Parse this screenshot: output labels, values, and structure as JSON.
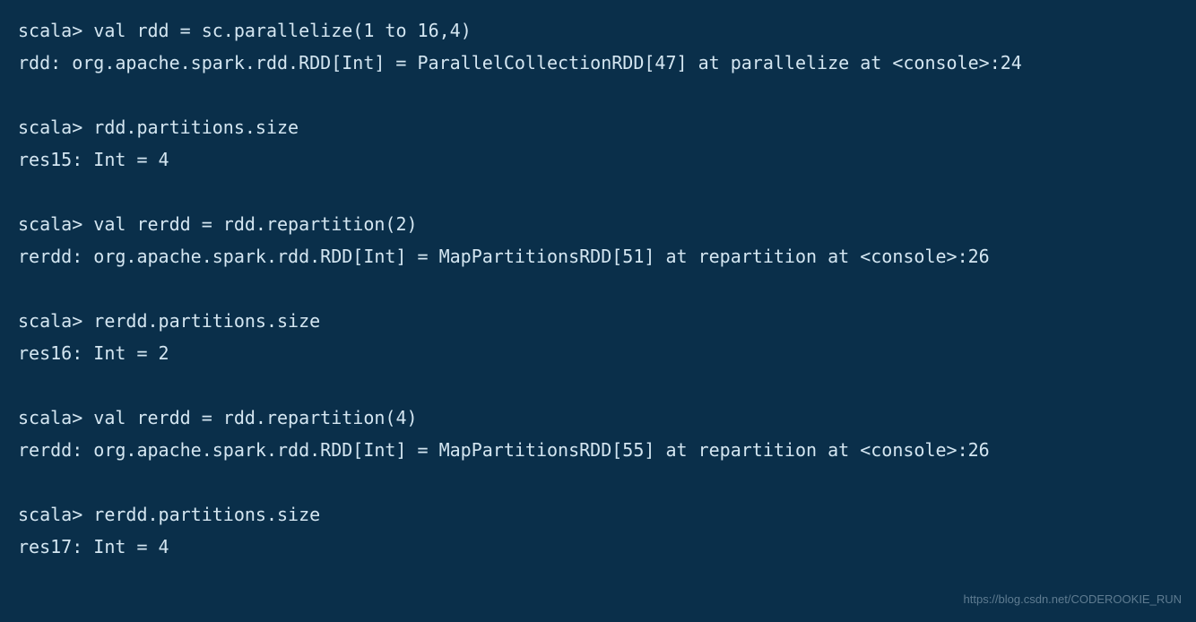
{
  "terminal": {
    "lines": [
      {
        "type": "prompt-command",
        "prompt": "scala> ",
        "command": "val rdd = sc.parallelize(1 to 16,4)"
      },
      {
        "type": "output",
        "text": "rdd: org.apache.spark.rdd.RDD[Int] = ParallelCollectionRDD[47] at parallelize at <console>:24"
      },
      {
        "type": "blank",
        "text": ""
      },
      {
        "type": "prompt-command",
        "prompt": "scala> ",
        "command": "rdd.partitions.size"
      },
      {
        "type": "output",
        "text": "res15: Int = 4"
      },
      {
        "type": "blank",
        "text": ""
      },
      {
        "type": "prompt-command",
        "prompt": "scala> ",
        "command": "val rerdd = rdd.repartition(2)"
      },
      {
        "type": "output",
        "text": "rerdd: org.apache.spark.rdd.RDD[Int] = MapPartitionsRDD[51] at repartition at <console>:26"
      },
      {
        "type": "blank",
        "text": ""
      },
      {
        "type": "prompt-command",
        "prompt": "scala> ",
        "command": "rerdd.partitions.size"
      },
      {
        "type": "output",
        "text": "res16: Int = 2"
      },
      {
        "type": "blank",
        "text": ""
      },
      {
        "type": "prompt-command",
        "prompt": "scala> ",
        "command": "val rerdd = rdd.repartition(4)"
      },
      {
        "type": "output",
        "text": "rerdd: org.apache.spark.rdd.RDD[Int] = MapPartitionsRDD[55] at repartition at <console>:26"
      },
      {
        "type": "blank",
        "text": ""
      },
      {
        "type": "prompt-command",
        "prompt": "scala> ",
        "command": "rerdd.partitions.size"
      },
      {
        "type": "output",
        "text": "res17: Int = 4"
      }
    ]
  },
  "watermark": "https://blog.csdn.net/CODEROOKIE_RUN"
}
